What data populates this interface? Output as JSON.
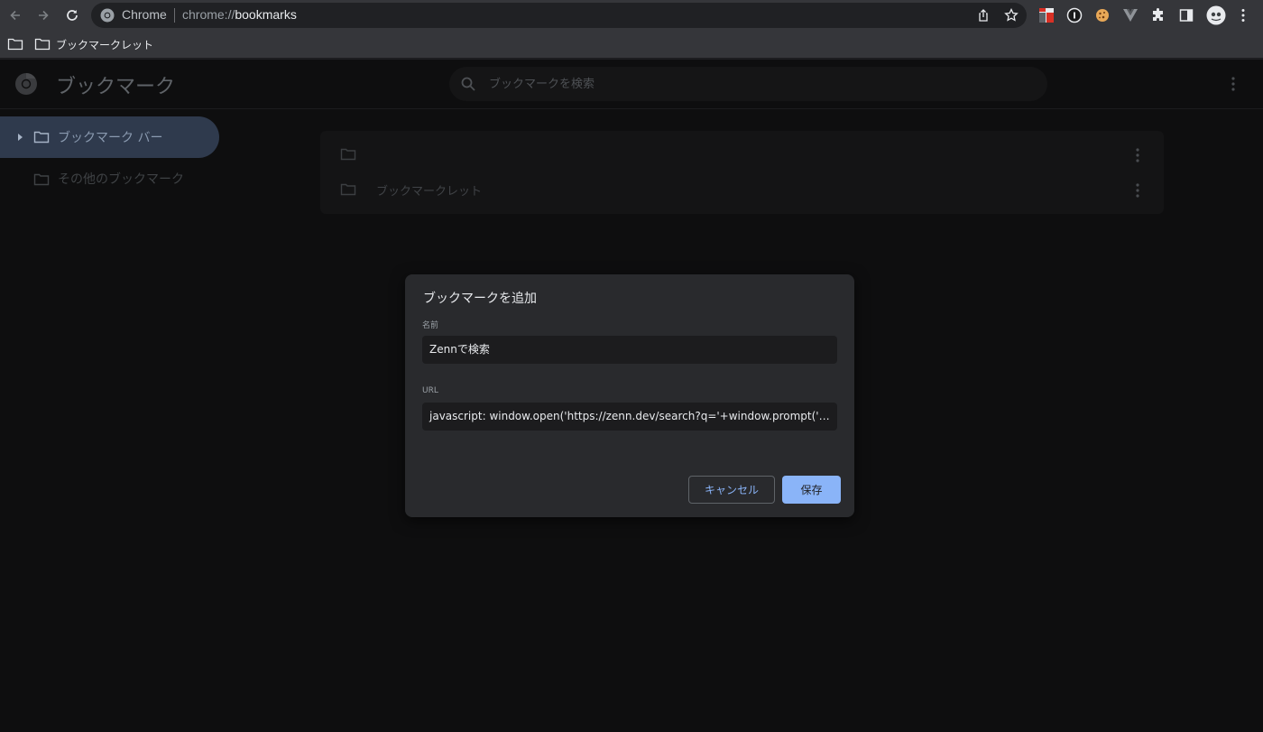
{
  "browser": {
    "omnibox": {
      "chip_label": "Chrome",
      "url_prefix": "chrome://",
      "url_host": "bookmarks"
    },
    "bookmarks_bar": {
      "items": [
        {
          "label": "ブックマークレット",
          "icon": "folder-icon"
        }
      ]
    }
  },
  "page": {
    "title": "ブックマーク",
    "search_placeholder": "ブックマークを検索"
  },
  "sidebar": {
    "items": [
      {
        "label": "ブックマーク バー",
        "selected": true,
        "expandable": true
      },
      {
        "label": "その他のブックマーク",
        "selected": false
      }
    ]
  },
  "list": {
    "rows": [
      {
        "label": "",
        "icon": "folder-icon"
      },
      {
        "label": "ブックマークレット",
        "icon": "folder-icon"
      }
    ]
  },
  "dialog": {
    "title": "ブックマークを追加",
    "name_label": "名前",
    "name_value": "Zennで検索",
    "url_label": "URL",
    "url_value": "javascript: window.open('https://zenn.dev/search?q='+window.prompt('zenn…",
    "cancel_label": "キャンセル",
    "save_label": "保存"
  },
  "colors": {
    "accent": "#8ab4f8",
    "sidebar_selected": "#2f3a4d"
  }
}
